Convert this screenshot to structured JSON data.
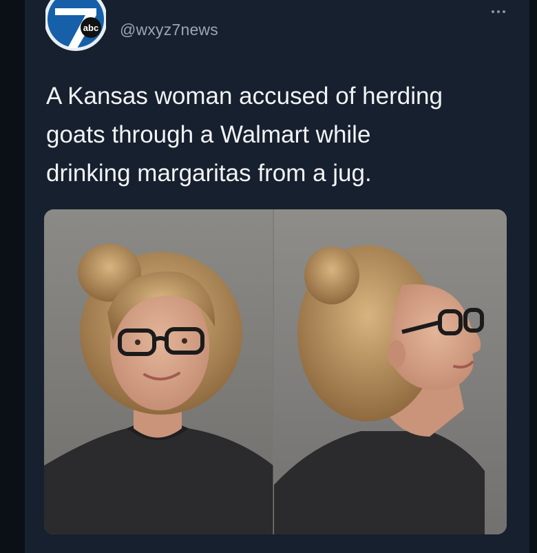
{
  "tweet": {
    "handle": "@wxyz7news",
    "avatar_icon": "wxyz-7-abc-logo",
    "avatar_letters": "abc",
    "avatar_numeral": "7",
    "text": "A Kansas woman accused of herding\ngoats through a Walmart while\ndrinking margaritas from a jug.",
    "more_icon": "more-options-icon",
    "media": {
      "panels": [
        "front-portrait",
        "profile-portrait"
      ]
    }
  },
  "colors": {
    "page_background": "#0b0f16",
    "card_background": "#17202e",
    "text_primary": "#f2f4f6",
    "text_secondary": "#9aa6b4",
    "brand_blue": "#1560a8"
  }
}
